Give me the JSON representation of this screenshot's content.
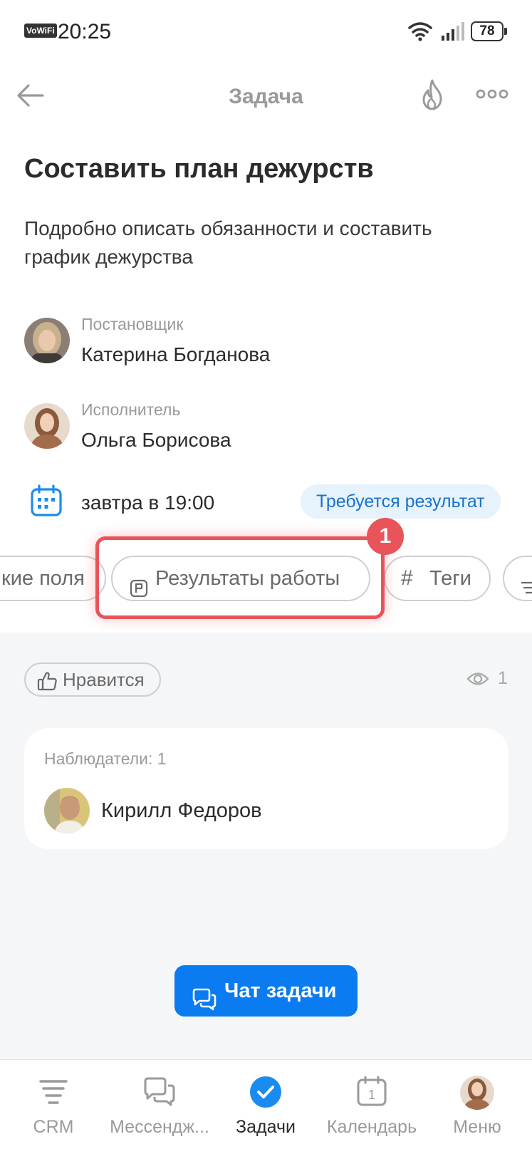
{
  "status_bar": {
    "vowifi": "VoWiFi",
    "time": "20:25",
    "battery": "78"
  },
  "header": {
    "title": "Задача"
  },
  "task": {
    "title": "Составить план дежурств",
    "description": "Подробно описать обязанности и составить график дежурства"
  },
  "creator": {
    "role": "Постановщик",
    "name": "Катерина Богданова"
  },
  "assignee": {
    "role": "Исполнитель",
    "name": "Ольга Борисова"
  },
  "deadline": {
    "text": "завтра в 19:00",
    "badge": "Требуется результат"
  },
  "chips": {
    "fields": "кие поля",
    "results": "Результаты работы",
    "tags": "Теги",
    "tags_hash": "#"
  },
  "annotation": {
    "step": "1",
    "color": "#e8545a"
  },
  "social": {
    "like": "Нравится",
    "views": "1"
  },
  "watchers": {
    "label": "Наблюдатели: 1",
    "items": [
      {
        "name": "Кирилл Федоров"
      }
    ]
  },
  "chat_button": {
    "label": "Чат задачи",
    "color": "#0a7bf0"
  },
  "tabbar": {
    "items": [
      {
        "label": "CRM",
        "icon": "crm-funnel-icon"
      },
      {
        "label": "Мессендж...",
        "icon": "messenger-icon"
      },
      {
        "label": "Задачи",
        "icon": "tasks-check-icon",
        "active": true
      },
      {
        "label": "Календарь",
        "icon": "calendar-icon",
        "day": "1"
      },
      {
        "label": "Меню",
        "icon": "menu-avatar-icon"
      }
    ]
  }
}
